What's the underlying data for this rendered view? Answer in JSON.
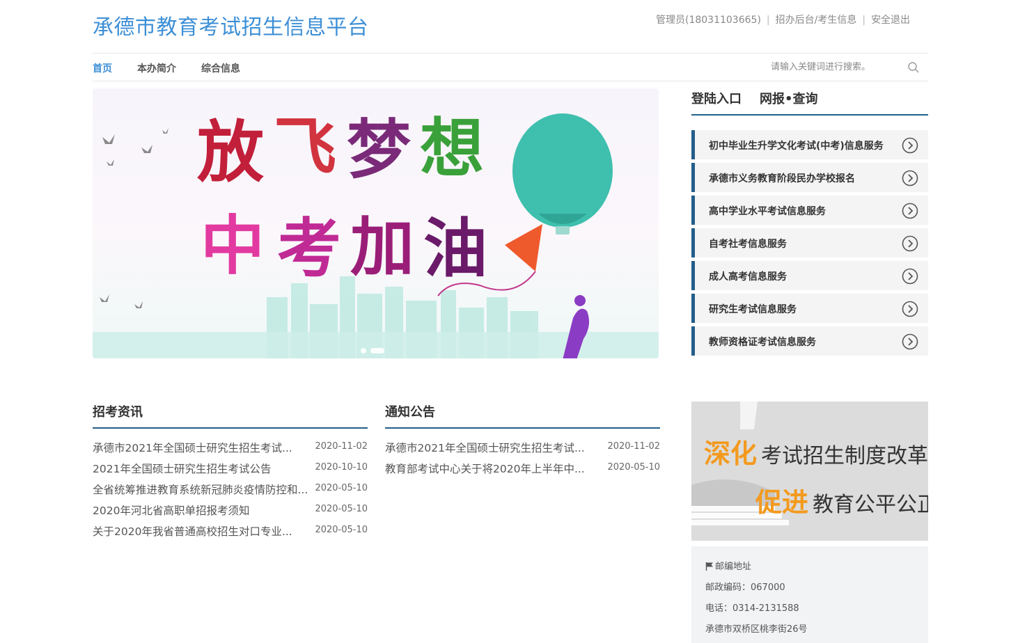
{
  "header": {
    "site_title": "承德市教育考试招生信息平台",
    "user_link": "管理员(18031103665)",
    "backend_link": "招办后台/考生信息",
    "logout_link": "安全退出",
    "separator": "|"
  },
  "nav": {
    "items": [
      {
        "label": "首页",
        "active": true
      },
      {
        "label": "本办简介",
        "active": false
      },
      {
        "label": "综合信息",
        "active": false
      }
    ]
  },
  "search": {
    "placeholder": "请输入关键词进行搜索。"
  },
  "banner": {
    "slides": 2,
    "active_slide": 2,
    "accent_colors": [
      "#c21f3a",
      "#e23aa0",
      "#3fbfae",
      "#ef5a2c"
    ]
  },
  "right_panel": {
    "tabs": [
      "登陆入口",
      "网报•查询"
    ],
    "services": [
      "初中毕业生升学文化考试(中考)信息服务",
      "承德市义务教育阶段民办学校报名",
      "高中学业水平考试信息服务",
      "自考社考信息服务",
      "成人高考信息服务",
      "研究生考试信息服务",
      "教师资格证考试信息服务"
    ]
  },
  "news": {
    "title": "招考资讯",
    "items": [
      {
        "title": "承德市2021年全国硕士研究生招生考试...",
        "date": "2020-11-02"
      },
      {
        "title": "2021年全国硕士研究生招生考试公告",
        "date": "2020-10-10"
      },
      {
        "title": "全省统筹推进教育系统新冠肺炎疫情防控和...",
        "date": "2020-05-10"
      },
      {
        "title": "2020年河北省高职单招报考须知",
        "date": "2020-05-10"
      },
      {
        "title": "关于2020年我省普通高校招生对口专业...",
        "date": "2020-05-10"
      }
    ]
  },
  "notices": {
    "title": "通知公告",
    "items": [
      {
        "title": "承德市2021年全国硕士研究生招生考试...",
        "date": "2020-11-02"
      },
      {
        "title": "教育部考试中心关于将2020年上半年中...",
        "date": "2020-05-10"
      }
    ]
  },
  "promo": {
    "line1_highlight": "深化",
    "line1_text": "考试招生制度改革",
    "line2_highlight": "促进",
    "line2_text": "教育公平公正"
  },
  "contact": {
    "heading": "邮编地址",
    "postcode": "邮政编码：067000",
    "phone": "电话：0314-2131588",
    "address": "承德市双桥区桃李街26号"
  },
  "colors": {
    "brand_blue": "#3d8fd6",
    "dark_blue": "#245e8a",
    "accent_orange": "#f39a1e"
  }
}
